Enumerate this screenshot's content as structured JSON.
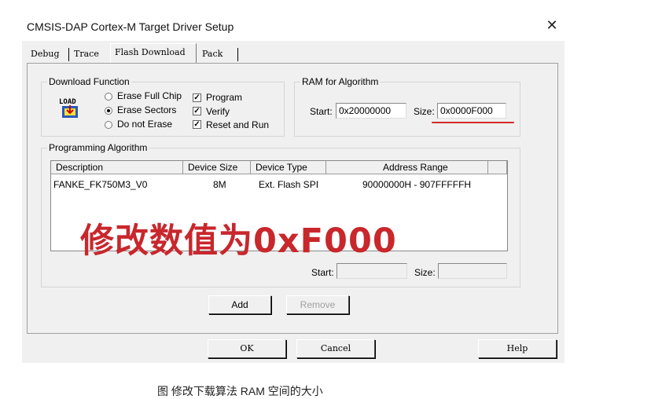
{
  "window": {
    "title": "CMSIS-DAP Cortex-M Target Driver Setup",
    "close_glyph": "✕"
  },
  "tabs": [
    {
      "label": "Debug",
      "active": false
    },
    {
      "label": "Trace",
      "active": false
    },
    {
      "label": "Flash Download",
      "active": true
    },
    {
      "label": "Pack",
      "active": false
    }
  ],
  "download_function": {
    "legend": "Download Function",
    "icon": "load-icon",
    "icon_text": "LOAD",
    "radios": [
      {
        "label": "Erase Full Chip",
        "checked": false
      },
      {
        "label": "Erase Sectors",
        "checked": true
      },
      {
        "label": "Do not Erase",
        "checked": false
      }
    ],
    "checkboxes": [
      {
        "label": "Program",
        "checked": true
      },
      {
        "label": "Verify",
        "checked": true
      },
      {
        "label": "Reset and Run",
        "checked": true
      }
    ]
  },
  "ram_for_algorithm": {
    "legend": "RAM for Algorithm",
    "start_label": "Start:",
    "start_value": "0x20000000",
    "size_label": "Size:",
    "size_value": "0x0000F000"
  },
  "programming_algorithm": {
    "legend": "Programming Algorithm",
    "columns": [
      "Description",
      "Device Size",
      "Device Type",
      "Address Range"
    ],
    "rows": [
      {
        "description": "FANKE_FK750M3_V0",
        "device_size": "8M",
        "device_type": "Ext. Flash SPI",
        "address_range": "90000000H - 907FFFFFH"
      }
    ],
    "start_label": "Start:",
    "start_value": "",
    "size_label": "Size:",
    "size_value": ""
  },
  "buttons": {
    "add": "Add",
    "remove": "Remove",
    "ok": "OK",
    "cancel": "Cancel",
    "help": "Help"
  },
  "annotation": {
    "text": "修改数值为0xF000",
    "color": "#c8272c"
  },
  "caption": "图      修改下载算法 RAM 空间的大小"
}
